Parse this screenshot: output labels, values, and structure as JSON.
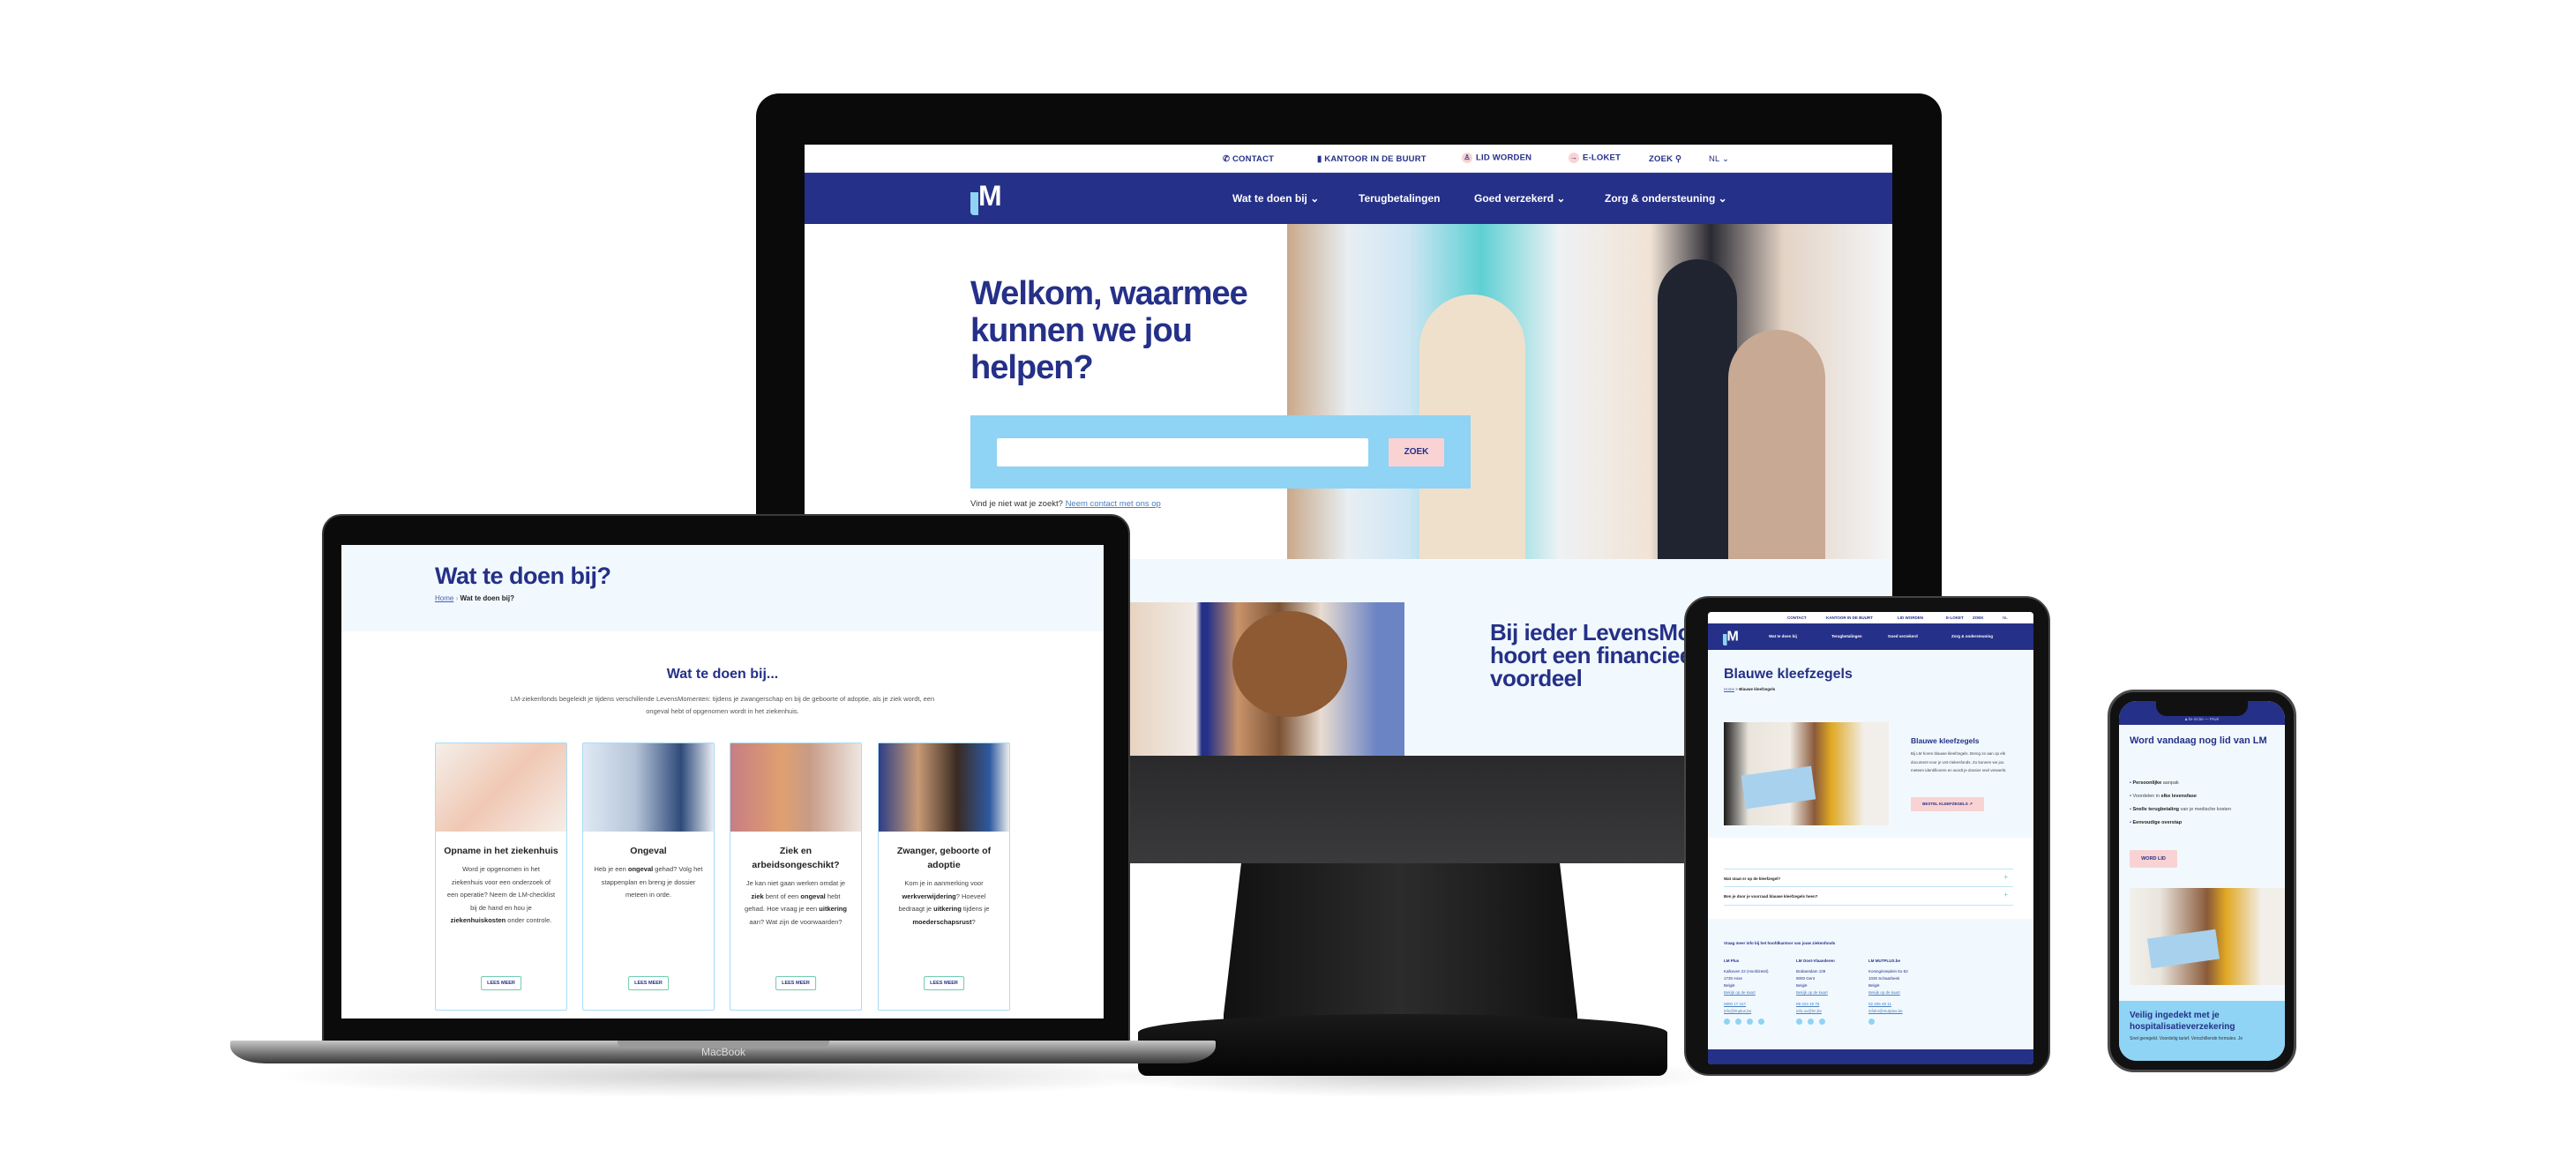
{
  "colors": {
    "navy": "#253088",
    "light_blue": "#8fd3f5",
    "pink": "#f9d3d3",
    "page_bg": "#f1f9fe",
    "card_border": "#a9dcf6"
  },
  "brand": {
    "logo_text": "LM"
  },
  "desktop": {
    "topbar": {
      "contact": "CONTACT",
      "office": "KANTOOR IN DE BUURT",
      "join": "LID WORDEN",
      "eloket": "E-LOKET",
      "search": "ZOEK",
      "language": "NL"
    },
    "nav": [
      {
        "label": "Wat te doen bij",
        "dropdown": true
      },
      {
        "label": "Terugbetalingen",
        "dropdown": false
      },
      {
        "label": "Goed verzekerd",
        "dropdown": true
      },
      {
        "label": "Zorg & ondersteuning",
        "dropdown": true
      }
    ],
    "hero": {
      "title_lines": [
        "Welkom, waarmee",
        "kunnen we jou",
        "helpen?"
      ],
      "search_value": "",
      "search_button": "ZOEK",
      "help_text": "Vind je niet wat je zoekt?",
      "help_link": "Neem contact met ons op"
    },
    "section2": {
      "title_lines": [
        "Bij ieder LevensMoment",
        "hoort een financieel",
        "voordeel"
      ]
    }
  },
  "laptop": {
    "brand_label": "MacBook",
    "page_title": "Wat te doen bij?",
    "breadcrumb": {
      "home": "Home",
      "sep": "›",
      "current": "Wat te doen bij?"
    },
    "section_title": "Wat te doen bij...",
    "intro": "LM-ziekenfonds begeleidt je tijdens verschillende LevensMomenten: tijdens je zwangerschap en bij de geboorte of adoptie, als je ziek wordt, een ongeval hebt of opgenomen wordt in het ziekenhuis.",
    "cards": [
      {
        "title": "Opname in het ziekenhuis",
        "desc": [
          {
            "t": "Word je opgenomen in het ziekenhuis voor een onderzoek of een operatie? Neem de LM-checklist bij de hand en hou je "
          },
          {
            "t": "ziekenhuiskosten",
            "b": true
          },
          {
            "t": " onder controle."
          }
        ],
        "button": "LEES MEER"
      },
      {
        "title": "Ongeval",
        "desc": [
          {
            "t": "Heb je een "
          },
          {
            "t": "ongeval",
            "b": true
          },
          {
            "t": " gehad? Volg het stappenplan en breng je dossier meteen in orde."
          }
        ],
        "button": "LEES MEER"
      },
      {
        "title": "Ziek en arbeidsongeschikt?",
        "desc": [
          {
            "t": "Je kan niet gaan werken omdat je "
          },
          {
            "t": "ziek",
            "b": true
          },
          {
            "t": " bent of een "
          },
          {
            "t": "ongeval",
            "b": true
          },
          {
            "t": " hebt gehad. Hoe vraag je een "
          },
          {
            "t": "uitkering",
            "b": true
          },
          {
            "t": " aan? Wat zijn de voorwaarden?"
          }
        ],
        "button": "LEES MEER"
      },
      {
        "title": "Zwanger, geboorte of adoptie",
        "desc": [
          {
            "t": "Kom je in aanmerking voor "
          },
          {
            "t": "werkverwijdering",
            "b": true
          },
          {
            "t": "? Hoeveel bedraagt je "
          },
          {
            "t": "uitkering",
            "b": true
          },
          {
            "t": " tijdens je "
          },
          {
            "t": "moederschapsrust",
            "b": true
          },
          {
            "t": "?"
          }
        ],
        "button": "LEES MEER"
      }
    ]
  },
  "tablet": {
    "page_title": "Blauwe kleefzegels",
    "breadcrumb": {
      "home": "Home",
      "sep": ">",
      "current": "Blauwe kleefzegels"
    },
    "feature": {
      "title": "Blauwe kleefzegels",
      "text": "Bij LM horen blauwe kleefzegels. Breng ze aan op elk document voor je LM-ziekenfonds. Zo kunnen we jou meteen identificeren en wordt je dossier snel verwerkt.",
      "button": "BESTEL KLEEFZEGELS"
    },
    "faq": [
      "Wat staat er op de kleefzegel?",
      "Ben je door je voorraad blauwe kleefzegels heen?"
    ],
    "footer": {
      "heading": "Vraag meer info bij het hoofdkantoor van jouw ziekenfonds",
      "columns": [
        {
          "name": "LM Plus",
          "lines": [
            "Kalkoven 22 (Hoofdzetel)",
            "1730 Asse",
            "België"
          ],
          "map": "Bekijk op de kaart",
          "phone": "0800 17 417",
          "email": "info@lmplus.be",
          "socials": [
            "facebook",
            "twitter",
            "instagram",
            "youtube"
          ]
        },
        {
          "name": "LM Oost-Vlaanderen",
          "lines": [
            "Brabantdam 109",
            "9000 Gent",
            "België"
          ],
          "map": "Bekijk op de kaart",
          "phone": "09 223 19 76",
          "email": "info.ov@lm.be",
          "socials": [
            "facebook",
            "instagram",
            "youtube"
          ]
        },
        {
          "name": "LM MUTPLUS.be",
          "lines": [
            "Koninginneplein 51-52",
            "1030 Schaarbeek",
            "België"
          ],
          "map": "Bekijk op de kaart",
          "phone": "02 205 48 11",
          "email": "infolm@mutplus.be",
          "socials": [
            "facebook"
          ]
        }
      ]
    }
  },
  "phone": {
    "url": "lm-ml.be — Privé",
    "title": "Word vandaag nog lid van LM",
    "bullets": [
      [
        {
          "t": "Persoonlijke",
          "b": true
        },
        {
          "t": " aanpak"
        }
      ],
      [
        {
          "t": "Voordelen in "
        },
        {
          "t": "elke levensfase",
          "b": true
        }
      ],
      [
        {
          "t": "Snelle terugbetaling",
          "b": true
        },
        {
          "t": " van je medische kosten"
        }
      ],
      [
        {
          "t": "Eenvoudige overstap",
          "b": true
        }
      ]
    ],
    "button": "WORD LID",
    "section_title": "Veilig ingedekt met je hospitalisatieverzekering",
    "section_text": "Snel geregeld. Voordelig tarief. Verschillende formules. Je"
  }
}
